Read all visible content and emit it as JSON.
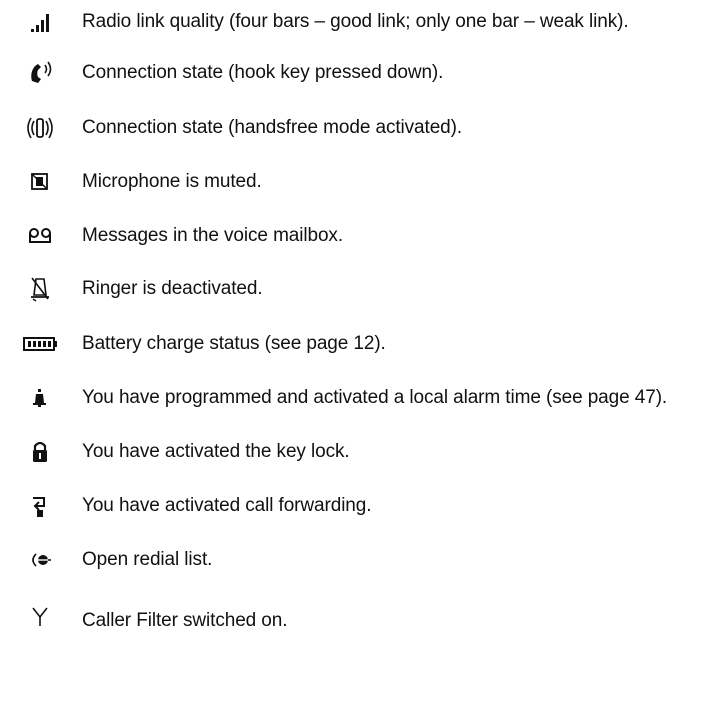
{
  "items": [
    {
      "icon": "signal-bars-icon",
      "text": "Radio link quality (four bars – good link; only one bar – weak link)."
    },
    {
      "icon": "handset-off-hook-icon",
      "text": "Connection state (hook key pressed down)."
    },
    {
      "icon": "handsfree-icon",
      "text": "Connection state (handsfree mode activated)."
    },
    {
      "icon": "microphone-muted-icon",
      "text": "Microphone is muted."
    },
    {
      "icon": "voice-mailbox-icon",
      "text": "Messages in the voice mailbox."
    },
    {
      "icon": "ringer-off-icon",
      "text": "Ringer is deactivated."
    },
    {
      "icon": "battery-icon",
      "text": "Battery charge status (see page 12)."
    },
    {
      "icon": "alarm-clock-icon",
      "text": "You have programmed and activated a local alarm time (see page 47)."
    },
    {
      "icon": "key-lock-icon",
      "text": "You have activated the key lock."
    },
    {
      "icon": "call-forwarding-icon",
      "text": "You have activated call forwarding."
    },
    {
      "icon": "redial-list-icon",
      "text": "Open redial list."
    },
    {
      "icon": "caller-filter-icon",
      "text": "Caller Filter switched on."
    }
  ]
}
